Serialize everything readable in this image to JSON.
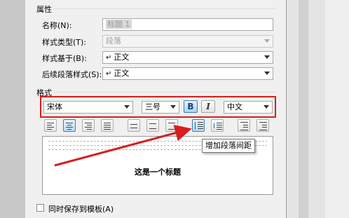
{
  "group_properties": {
    "title": "属性"
  },
  "properties": {
    "name": {
      "label": "名称(N):",
      "value": "标题 1"
    },
    "style_type": {
      "label": "样式类型(T):",
      "value": "段落"
    },
    "based_on": {
      "label": "样式基于(B):",
      "value": "正文"
    },
    "next_style": {
      "label": "后续段落样式(S):",
      "value": "正文"
    }
  },
  "group_format": {
    "title": "格式"
  },
  "format": {
    "font": "宋体",
    "size": "三号",
    "bold": "B",
    "italic": "I",
    "script": "中文"
  },
  "preview": {
    "heading": "这是一个标题",
    "sample_line": "前一段落 前一段落 前一段落 前一段落 前一段落 前一段落"
  },
  "tooltip": {
    "text": "增加段落间距"
  },
  "save_template": {
    "label": "同时保存到模板(A)"
  },
  "icons": [
    "return-arrow-icon",
    "align-left-icon",
    "align-center-icon",
    "align-right-icon",
    "justify-icon",
    "spacing-single-icon",
    "spacing-1-5-icon",
    "spacing-double-icon",
    "increase-paragraph-spacing-icon",
    "decrease-paragraph-spacing-icon",
    "decrease-indent-icon",
    "increase-indent-icon"
  ],
  "annotation_color": "#d81e1e"
}
